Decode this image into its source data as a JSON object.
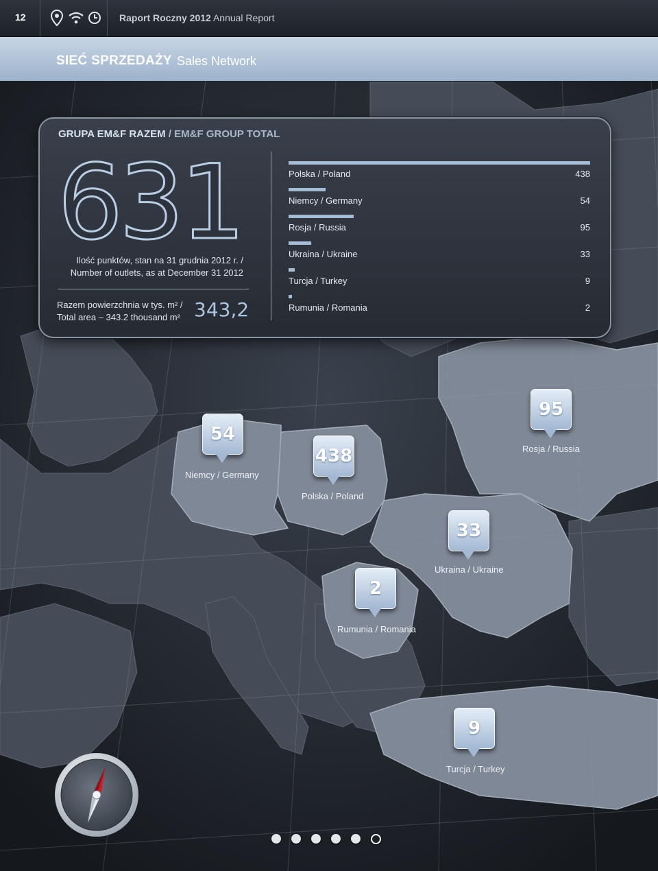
{
  "page_number": "12",
  "report_title": {
    "bold": "Raport Roczny 2012",
    "light": "Annual Report"
  },
  "top_icons": [
    "location-pin-icon",
    "wifi-icon",
    "clock-icon"
  ],
  "header": {
    "title_pl": "SIEĆ SPRZEDAŻY",
    "title_en": "Sales Network"
  },
  "summary": {
    "title_pl": "GRUPA EM&F RAZEM",
    "title_en": "/ EM&F GROUP TOTAL",
    "total_outlets": "631",
    "outlets_label_pl": "Ilość punktów, stan na 31 grudnia 2012 r. /",
    "outlets_label_en": "Number of outlets, as at December 31 2012",
    "area_label_pl": "Razem powierzchnia w tys. m² /",
    "area_label_en": "Total area – 343.2 thousand m²",
    "area_value": "343,2"
  },
  "countries": [
    {
      "label": "Polska / Poland",
      "value": "438",
      "outlets": 438
    },
    {
      "label": "Niemcy / Germany",
      "value": "54",
      "outlets": 54
    },
    {
      "label": "Rosja / Russia",
      "value": "95",
      "outlets": 95
    },
    {
      "label": "Ukraina / Ukraine",
      "value": "33",
      "outlets": 33
    },
    {
      "label": "Turcja / Turkey",
      "value": "9",
      "outlets": 9
    },
    {
      "label": "Rumunia / Romania",
      "value": "2",
      "outlets": 2
    }
  ],
  "map_pins": [
    {
      "number": "54",
      "label": "Niemcy / Germany"
    },
    {
      "number": "438",
      "label": "Polska / Poland"
    },
    {
      "number": "95",
      "label": "Rosja / Russia"
    },
    {
      "number": "33",
      "label": "Ukraina / Ukraine"
    },
    {
      "number": "2",
      "label": "Rumunia / Romania"
    },
    {
      "number": "9",
      "label": "Turcja / Turkey"
    }
  ],
  "colors": {
    "accent": "#a5bcd6",
    "header_band": "#b3c6dd",
    "highlight_countries": "#7f8896",
    "sea": "#1c2027"
  },
  "compass_icon": "compass-icon",
  "pagination": {
    "total": 6,
    "active_index": 5
  }
}
